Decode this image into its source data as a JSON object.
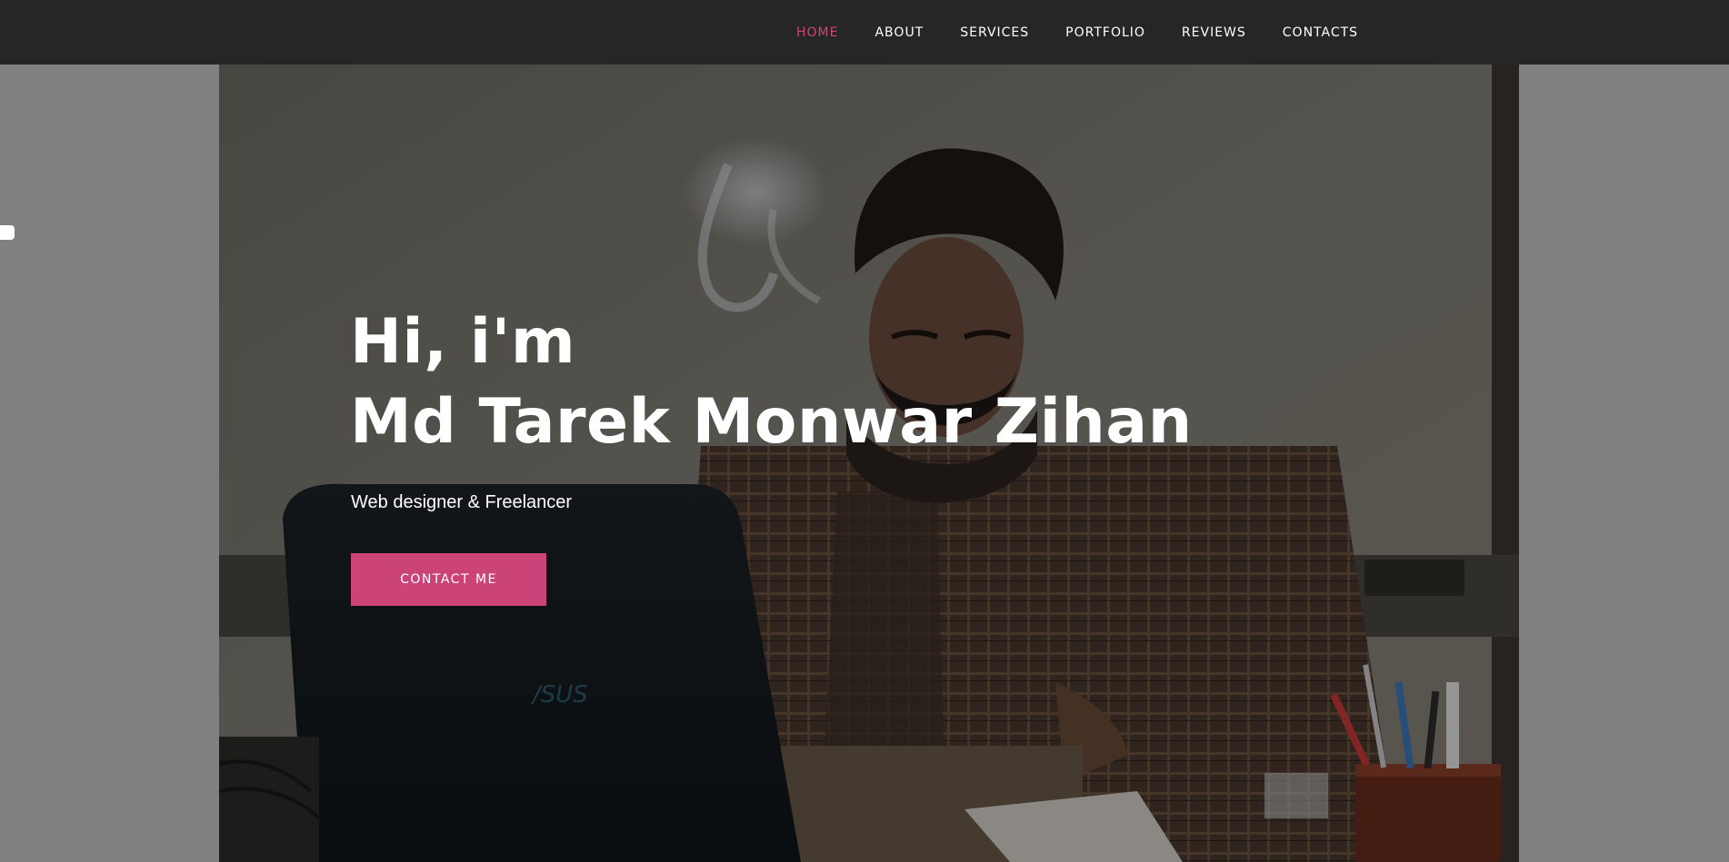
{
  "nav": {
    "items": [
      {
        "label": "HOME",
        "active": true
      },
      {
        "label": "ABOUT",
        "active": false
      },
      {
        "label": "SERVICES",
        "active": false
      },
      {
        "label": "PORTFOLIO",
        "active": false
      },
      {
        "label": "REVIEWS",
        "active": false
      },
      {
        "label": "CONTACTS",
        "active": false
      }
    ]
  },
  "hero": {
    "greeting": "Hi, i'm",
    "name": "Md Tarek Monwar Zihan",
    "subtitle": "Web designer & Freelancer",
    "cta_label": "CONTACT ME",
    "laptop_logo": "/SUS"
  },
  "colors": {
    "accent": "#cc4378",
    "nav_active": "#d1447a",
    "navbar_bg": "#262626",
    "page_bg": "#808080"
  }
}
